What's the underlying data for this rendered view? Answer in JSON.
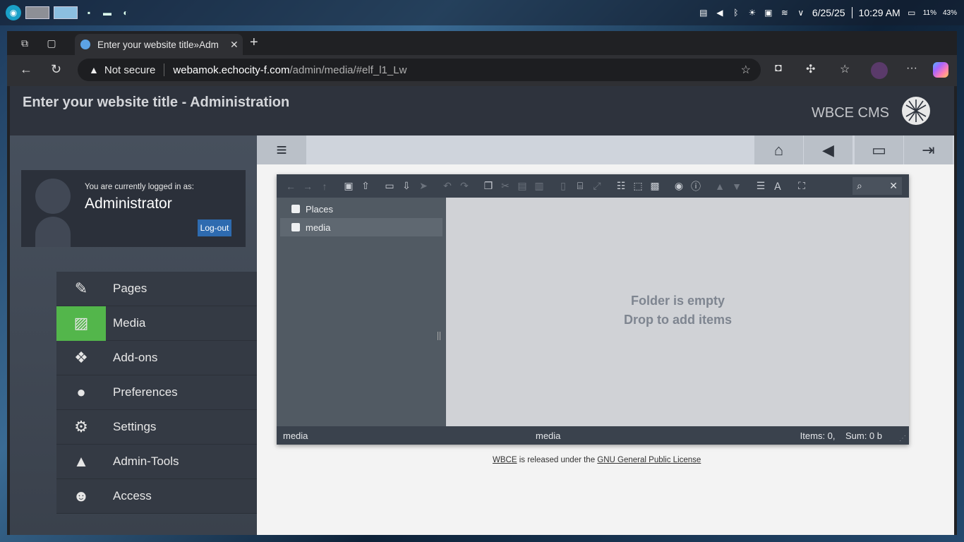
{
  "taskbar": {
    "date": "6/25/25",
    "time": "10:29 AM",
    "battery_a": "11%",
    "battery_b": "43%"
  },
  "browser": {
    "tab_title": "Enter your website title»Adm",
    "not_secure": "Not secure",
    "url_host": "webamok.echocity-f.com",
    "url_path": "/admin/media/#elf_l1_Lw"
  },
  "header": {
    "site_title": "Enter your website title - Administration",
    "brand": "WBCE CMS"
  },
  "login": {
    "label": "You are currently logged in as:",
    "user": "Administrator",
    "logout": "Log-out"
  },
  "menu": {
    "items": [
      {
        "label": "Pages",
        "icon": "edit-icon"
      },
      {
        "label": "Media",
        "icon": "image-icon"
      },
      {
        "label": "Add-ons",
        "icon": "cubes-icon"
      },
      {
        "label": "Preferences",
        "icon": "user-icon"
      },
      {
        "label": "Settings",
        "icon": "gears-icon"
      },
      {
        "label": "Admin-Tools",
        "icon": "graduation-cap-icon"
      },
      {
        "label": "Access",
        "icon": "users-icon"
      }
    ],
    "active": "Media"
  },
  "elfinder": {
    "nav": {
      "places": "Places",
      "root": "media"
    },
    "empty_line1": "Folder is empty",
    "empty_line2": "Drop to add items",
    "status": {
      "path": "media",
      "center": "media",
      "items": "Items: 0,",
      "sum": "Sum: 0 b"
    }
  },
  "footer": {
    "link1": "WBCE",
    "text1": " is released under the ",
    "link2": "GNU General Public License"
  },
  "colors": {
    "accent_green": "#53b64b",
    "logout_blue": "#2e6bb0",
    "header_bg": "#2e333d"
  }
}
